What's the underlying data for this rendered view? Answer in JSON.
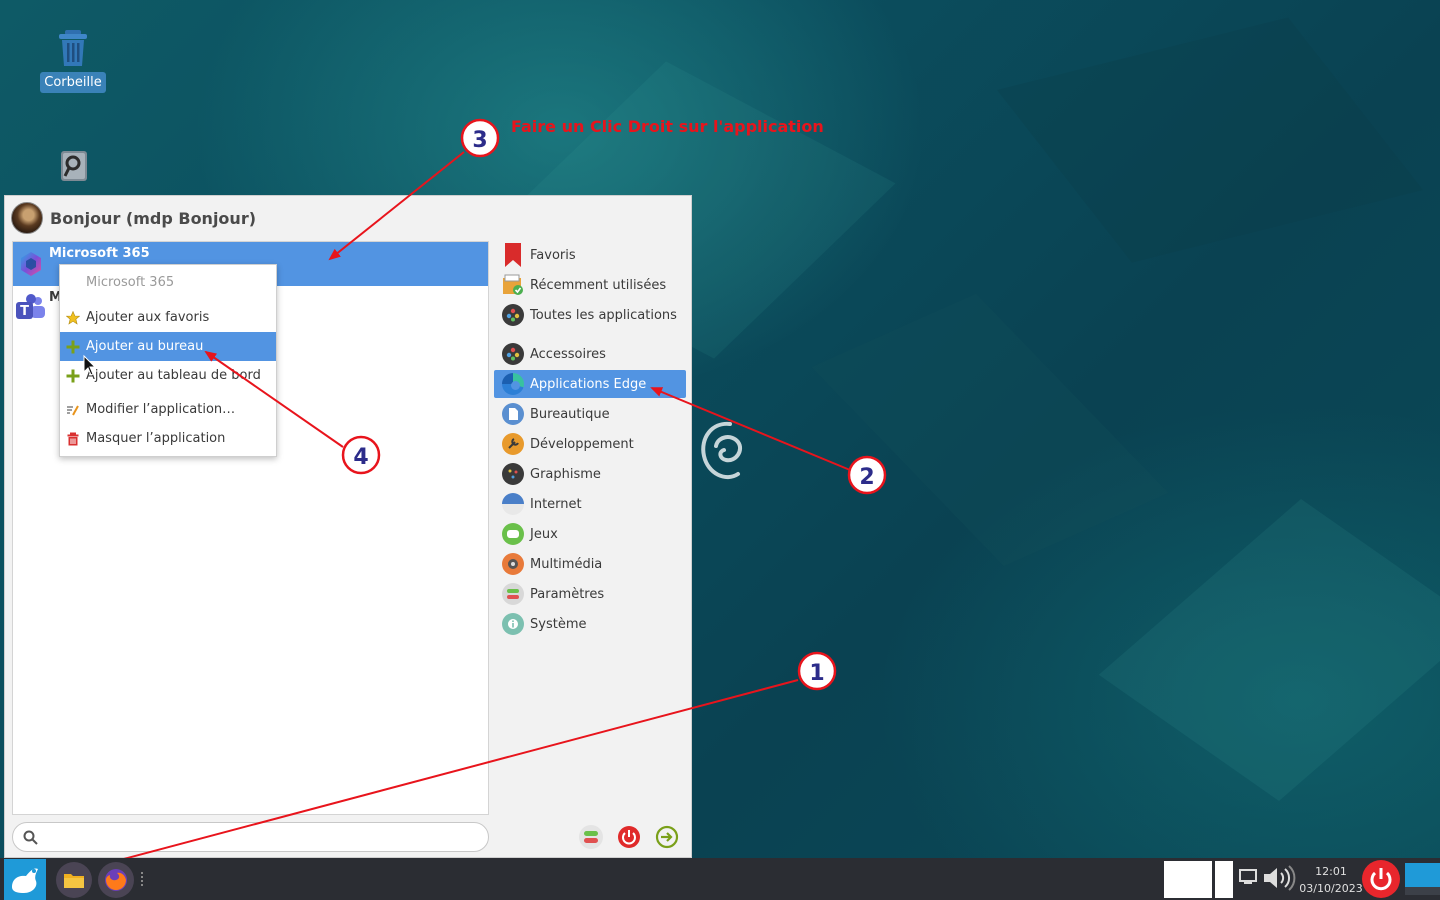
{
  "desktop": {
    "icons": [
      {
        "label": "Corbeille",
        "icon": "trash-icon"
      },
      {
        "label": "",
        "icon": "disk-search-icon"
      }
    ]
  },
  "menu": {
    "header": {
      "username": "Bonjour (mdp Bonjour)"
    },
    "apps": [
      {
        "name": "Microsoft 365",
        "icon": "microsoft-365-icon",
        "selected": true
      },
      {
        "name": "M",
        "icon": "teams-icon",
        "selected": false
      }
    ],
    "categories": [
      {
        "label": "Favoris",
        "icon": "bookmark-icon"
      },
      {
        "label": "Récemment utilisées",
        "icon": "recent-icon"
      },
      {
        "label": "Toutes les applications",
        "icon": "all-apps-icon"
      },
      {
        "label": "Accessoires",
        "icon": "accessories-icon"
      },
      {
        "label": "Applications Edge",
        "icon": "edge-icon",
        "selected": true
      },
      {
        "label": "Bureautique",
        "icon": "office-icon"
      },
      {
        "label": "Développement",
        "icon": "development-icon"
      },
      {
        "label": "Graphisme",
        "icon": "graphics-icon"
      },
      {
        "label": "Internet",
        "icon": "internet-icon"
      },
      {
        "label": "Jeux",
        "icon": "games-icon"
      },
      {
        "label": "Multimédia",
        "icon": "multimedia-icon"
      },
      {
        "label": "Paramètres",
        "icon": "settings-icon"
      },
      {
        "label": "Système",
        "icon": "system-icon"
      }
    ],
    "search": {
      "value": "",
      "placeholder": ""
    },
    "actions": [
      "settings-toggle-icon",
      "power-icon",
      "logout-icon"
    ]
  },
  "context_menu": {
    "title": "Microsoft 365",
    "items": [
      {
        "label": "Ajouter aux favoris",
        "icon": "star-icon"
      },
      {
        "label": "Ajouter au bureau",
        "icon": "plus-icon",
        "selected": true
      },
      {
        "label": "Ajouter au tableau de bord",
        "icon": "plus-icon"
      },
      {
        "label": "Modifier l’application…",
        "icon": "edit-icon"
      },
      {
        "label": "Masquer l’application",
        "icon": "delete-icon"
      }
    ]
  },
  "annotations": {
    "instruction": "Faire un Clic Droit sur l'application",
    "markers": [
      "1",
      "2",
      "3",
      "4"
    ],
    "color": "#e8141c"
  },
  "taskbar": {
    "clock": {
      "time": "12:01",
      "date": "03/10/2023"
    }
  },
  "colors": {
    "accent": "#5294e2",
    "annotation": "#e8141c",
    "taskbar": "#2b2d33"
  }
}
